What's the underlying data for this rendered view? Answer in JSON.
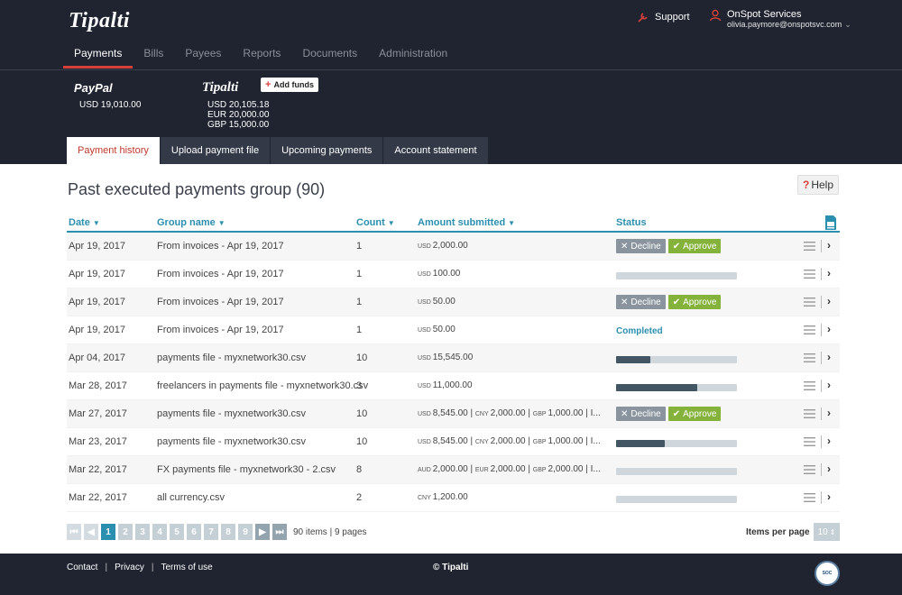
{
  "header": {
    "logo": "Tipalti",
    "support_label": "Support",
    "account_name": "OnSpot Services",
    "account_email": "olivia.paymore@onspotsvc.com",
    "nav": [
      {
        "label": "Payments",
        "active": true
      },
      {
        "label": "Bills"
      },
      {
        "label": "Payees"
      },
      {
        "label": "Reports"
      },
      {
        "label": "Documents"
      },
      {
        "label": "Administration"
      }
    ]
  },
  "balances": {
    "paypal_logo": "PayPal",
    "paypal_amount": "USD 19,010.00",
    "tipalti_logo": "Tipalti",
    "tipalti_amounts": [
      "USD 20,105.18",
      "EUR 20,000.00",
      "GBP 15,000.00"
    ],
    "add_funds_label": "Add funds"
  },
  "tabs": [
    {
      "label": "Payment history",
      "active": true
    },
    {
      "label": "Upload payment file"
    },
    {
      "label": "Upcoming payments"
    },
    {
      "label": "Account statement"
    }
  ],
  "main": {
    "title": "Past executed payments group (90)",
    "help_label": "Help",
    "columns": {
      "date": "Date",
      "group": "Group name",
      "count": "Count",
      "amount": "Amount submitted",
      "status": "Status"
    },
    "decline_label": "Decline",
    "approve_label": "Approve",
    "rows": [
      {
        "date": "Apr 19, 2017",
        "group": "From invoices - Apr 19, 2017",
        "count": "1",
        "amounts": [
          [
            "USD",
            "2,000.00"
          ]
        ],
        "status": "approve"
      },
      {
        "date": "Apr 19, 2017",
        "group": "From invoices - Apr 19, 2017",
        "count": "1",
        "amounts": [
          [
            "USD",
            "100.00"
          ]
        ],
        "status": "progress",
        "progress": 0
      },
      {
        "date": "Apr 19, 2017",
        "group": "From invoices - Apr 19, 2017",
        "count": "1",
        "amounts": [
          [
            "USD",
            "50.00"
          ]
        ],
        "status": "approve"
      },
      {
        "date": "Apr 19, 2017",
        "group": "From invoices - Apr 19, 2017",
        "count": "1",
        "amounts": [
          [
            "USD",
            "50.00"
          ]
        ],
        "status": "completed",
        "status_text": "Completed"
      },
      {
        "date": "Apr 04, 2017",
        "group": "payments file - myxnetwork30.csv",
        "count": "10",
        "amounts": [
          [
            "USD",
            "15,545.00"
          ]
        ],
        "status": "progress",
        "progress": 0.28
      },
      {
        "date": "Mar 28, 2017",
        "group": "freelancers in payments file - myxnetwork30.csv",
        "count": "3",
        "amounts": [
          [
            "USD",
            "11,000.00"
          ]
        ],
        "status": "progress",
        "progress": 0.67
      },
      {
        "date": "Mar 27, 2017",
        "group": "payments file - myxnetwork30.csv",
        "count": "10",
        "amounts": [
          [
            "USD",
            "8,545.00"
          ],
          [
            "CNY",
            "2,000.00"
          ],
          [
            "GBP",
            "1,000.00"
          ]
        ],
        "truncated": true,
        "status": "approve"
      },
      {
        "date": "Mar 23, 2017",
        "group": "payments file - myxnetwork30.csv",
        "count": "10",
        "amounts": [
          [
            "USD",
            "8,545.00"
          ],
          [
            "CNY",
            "2,000.00"
          ],
          [
            "GBP",
            "1,000.00"
          ]
        ],
        "truncated": true,
        "status": "progress",
        "progress": 0.4
      },
      {
        "date": "Mar 22, 2017",
        "group": "FX payments file - myxnetwork30 - 2.csv",
        "count": "8",
        "amounts": [
          [
            "AUD",
            "2,000.00"
          ],
          [
            "EUR",
            "2,000.00"
          ],
          [
            "GBP",
            "2,000.00"
          ]
        ],
        "truncated": true,
        "status": "progress",
        "progress": 0
      },
      {
        "date": "Mar 22, 2017",
        "group": "all currency.csv",
        "count": "2",
        "amounts": [
          [
            "CNY",
            "1,200.00"
          ]
        ],
        "status": "progress",
        "progress": 0
      }
    ]
  },
  "pagination": {
    "pages": [
      "1",
      "2",
      "3",
      "4",
      "5",
      "6",
      "7",
      "8",
      "9"
    ],
    "active_page": "1",
    "info": "90 items | 9 pages",
    "items_per_page_label": "Items per page",
    "items_per_page_value": "10"
  },
  "footer": {
    "contact": "Contact",
    "privacy": "Privacy",
    "terms": "Terms of use",
    "copyright": "© Tipalti",
    "badge": "SOC"
  },
  "colors": {
    "header_bg": "#1f2430",
    "accent_red": "#d6403a",
    "link_blue": "#2b8fb0",
    "approve_green": "#84b23a",
    "decline_gray": "#8a949e"
  }
}
